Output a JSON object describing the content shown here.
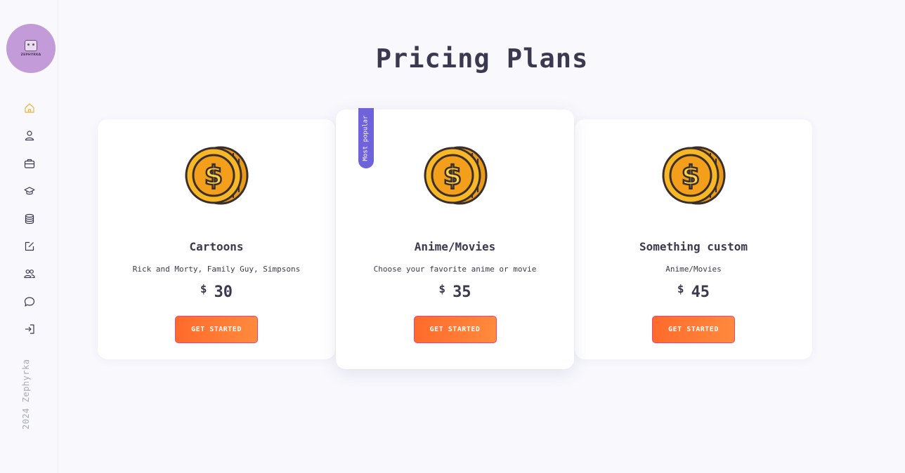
{
  "sidebar": {
    "logo_text": "ZEPHYRKA",
    "footer": "2024 Zephyrka",
    "items": [
      {
        "icon": "home-icon",
        "active": true
      },
      {
        "icon": "user-icon",
        "active": false
      },
      {
        "icon": "briefcase-icon",
        "active": false
      },
      {
        "icon": "graduation-cap-icon",
        "active": false
      },
      {
        "icon": "database-icon",
        "active": false
      },
      {
        "icon": "edit-icon",
        "active": false
      },
      {
        "icon": "users-icon",
        "active": false
      },
      {
        "icon": "chat-icon",
        "active": false
      },
      {
        "icon": "sign-in-icon",
        "active": false
      }
    ]
  },
  "colors": {
    "accent_active": "#f5b335",
    "icon_default": "#3b3950",
    "button_start": "#ff6a2b",
    "button_end": "#ff8a3d",
    "badge": "#6f63dc"
  },
  "page": {
    "title": "Pricing Plans"
  },
  "plans": [
    {
      "name": "Cartoons",
      "description": "Rick and Morty, Family Guy, Simpsons",
      "currency": "$",
      "price": "30",
      "button_label": "GET STARTED"
    },
    {
      "name": "Anime/Movies",
      "description": "Choose your favorite anime or movie",
      "currency": "$",
      "price": "35",
      "button_label": "GET STARTED",
      "badge": "Most popular"
    },
    {
      "name": "Something custom",
      "description": "Anime/Movies",
      "currency": "$",
      "price": "45",
      "button_label": "GET STARTED"
    }
  ]
}
